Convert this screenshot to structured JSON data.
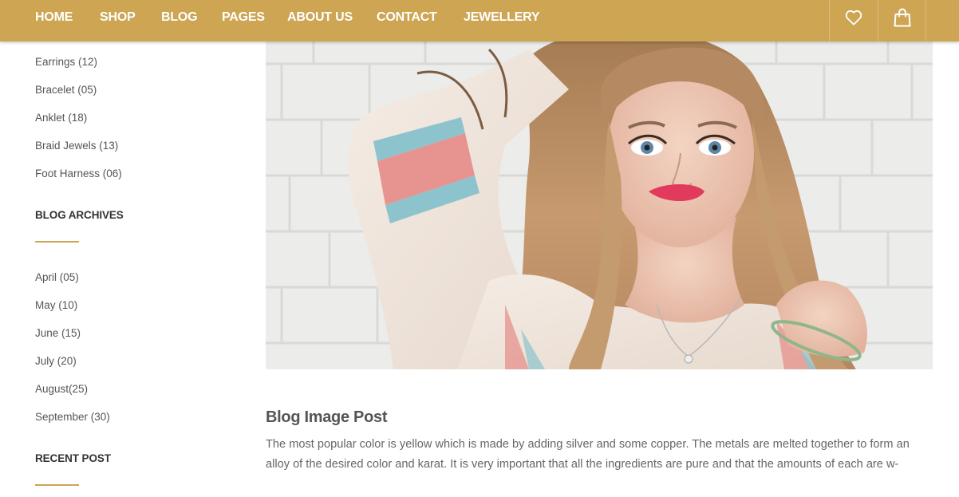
{
  "nav": {
    "items": [
      "HOME",
      "SHOP",
      "BLOG",
      "PAGES",
      "ABOUT US",
      "CONTACT",
      "JEWELLERY"
    ],
    "icons": [
      "heart-icon",
      "shopping-bag-icon"
    ],
    "color": "#cda553"
  },
  "sidebar": {
    "categories": [
      "Earrings (12)",
      "Bracelet (05)",
      "Anklet (18)",
      "Braid Jewels (13)",
      "Foot Harness (06)"
    ],
    "archives_heading": "BLOG ARCHIVES",
    "archives": [
      "April (05)",
      "May (10)",
      "June (15)",
      "July (20)",
      "August(25)",
      "September (30)"
    ],
    "recent_heading": "RECENT POST"
  },
  "post": {
    "image": "portrait-photo",
    "title": "Blog Image Post",
    "excerpt": "The most popular color is yellow which is made by adding silver and some copper. The metals are melted together to form an alloy of the desired color and karat. It is very important that all the ingredients are pure and that the amounts of each are w-"
  }
}
